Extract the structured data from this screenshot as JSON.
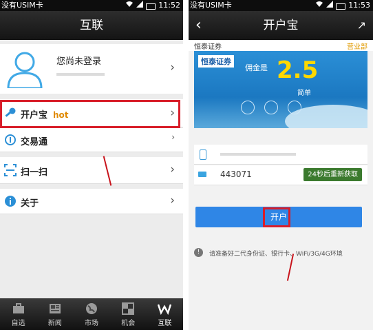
{
  "left": {
    "status": {
      "carrier": "没有USIM卡",
      "time": "11:52"
    },
    "title": "互联",
    "profile": {
      "name": "您尚未登录"
    },
    "menu": [
      {
        "label": "开户宝",
        "badge": "hot",
        "icon": "key-icon"
      },
      {
        "label": "交易通",
        "icon": "info-circle-icon"
      },
      {
        "label": "扫一扫",
        "icon": "scan-icon"
      },
      {
        "label": "关于",
        "icon": "info-icon"
      }
    ],
    "tabs": [
      {
        "label": "自选",
        "icon": "briefcase-icon"
      },
      {
        "label": "新闻",
        "icon": "newspaper-icon"
      },
      {
        "label": "市场",
        "icon": "globe-icon"
      },
      {
        "label": "机会",
        "icon": "grid-icon"
      },
      {
        "label": "互联",
        "icon": "w-logo-icon",
        "active": true
      }
    ]
  },
  "right": {
    "status": {
      "carrier": "没有USIM卡",
      "time": "11:53"
    },
    "title": "开户宝",
    "brand": "恒泰证券",
    "branch": "营业部",
    "banner": {
      "logo": "恒泰证券",
      "label": "佣金是",
      "big": "2.5",
      "sub": "简单"
    },
    "code_value": "443071",
    "code_button": "24秒后重新获取",
    "open_button": "开户",
    "notice": "请准备好二代身份证、银行卡、WiFi/3G/4G环境"
  },
  "colors": {
    "hot": "#e08a00",
    "highlight": "#d81e2a",
    "primary": "#2f86e6",
    "code_btn": "#3b7a2e",
    "branch": "#e09a00"
  }
}
